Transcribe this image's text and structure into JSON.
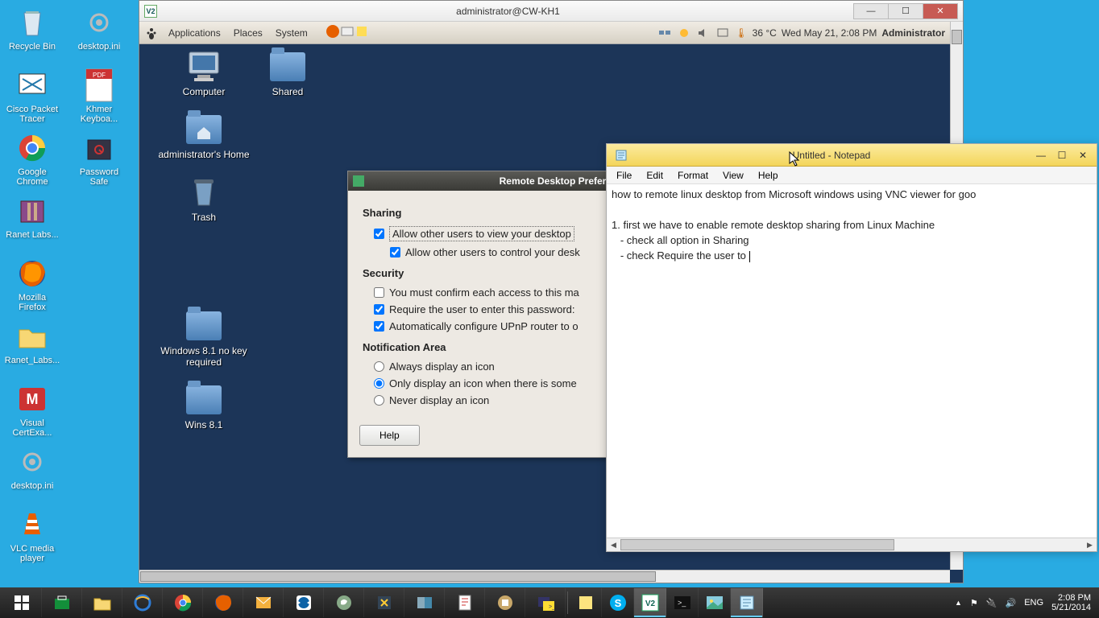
{
  "win_desktop": {
    "icons": [
      {
        "name": "recycle-bin",
        "label": "Recycle Bin"
      },
      {
        "name": "cisco-packet-tracer",
        "label": "Cisco Packet Tracer"
      },
      {
        "name": "google-chrome",
        "label": "Google Chrome"
      },
      {
        "name": "ranet-labs",
        "label": "Ranet Labs..."
      },
      {
        "name": "mozilla-firefox",
        "label": "Mozilla Firefox"
      },
      {
        "name": "ranet-labs2",
        "label": "Ranet_Labs..."
      },
      {
        "name": "visual-certexam",
        "label": "Visual CertExa..."
      },
      {
        "name": "desktop-ini",
        "label": "desktop.ini"
      },
      {
        "name": "vlc-media-player",
        "label": "VLC media player"
      },
      {
        "name": "desktop-ini2",
        "label": "desktop.ini"
      },
      {
        "name": "khmer-keyboard",
        "label": "Khmer Keyboa..."
      },
      {
        "name": "password-safe",
        "label": "Password Safe"
      }
    ]
  },
  "vnc": {
    "title": "administrator@CW-KH1",
    "logo": "V2"
  },
  "gnome": {
    "menus": [
      "Applications",
      "Places",
      "System"
    ],
    "temp": "36 °C",
    "datetime": "Wed May 21,  2:08 PM",
    "user": "Administrator",
    "icons": [
      {
        "name": "computer",
        "label": "Computer"
      },
      {
        "name": "home",
        "label": "administrator's Home"
      },
      {
        "name": "trash",
        "label": "Trash"
      },
      {
        "name": "win81-nokey",
        "label": "Windows 8.1 no key required"
      },
      {
        "name": "wins81",
        "label": "Wins 8.1"
      }
    ],
    "shared_icon": {
      "name": "shared",
      "label": "Shared"
    }
  },
  "prefs": {
    "title": "Remote Desktop Prefer",
    "sharing_heading": "Sharing",
    "opt_view": "Allow other users to view your desktop",
    "opt_control": "Allow other users to control your desk",
    "security_heading": "Security",
    "opt_confirm": "You must confirm each access to this ma",
    "opt_password": "Require the user to enter this password:",
    "opt_upnp": "Automatically configure UPnP router to o",
    "notify_heading": "Notification Area",
    "opt_always": "Always display an icon",
    "opt_only": "Only display an icon when there is some",
    "opt_never": "Never display an icon",
    "help": "Help"
  },
  "notepad": {
    "title": "Untitled - Notepad",
    "menus": [
      "File",
      "Edit",
      "Format",
      "View",
      "Help"
    ],
    "line1": "how to remote linux desktop from Microsoft windows using VNC viewer for goo",
    "line2": "",
    "line3": "1. first we have to enable remote desktop sharing from Linux Machine",
    "line4": "   - check all option in Sharing",
    "line5": "   - check Require the user to "
  },
  "taskbar": {
    "lang": "ENG",
    "time": "2:08 PM",
    "date": "5/21/2014"
  }
}
